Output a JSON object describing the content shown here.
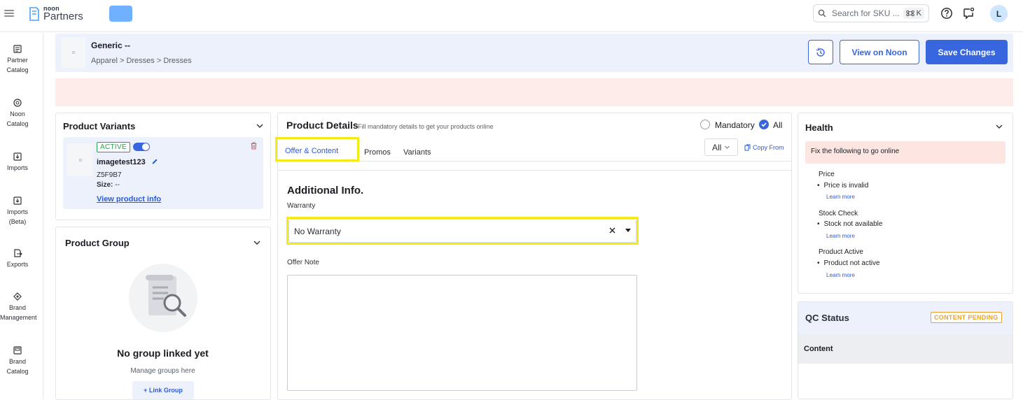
{
  "topbar": {
    "logo_noon": "noon",
    "logo_partners": "Partners",
    "search_placeholder": "Search for SKU ...",
    "search_shortcut_key": "K",
    "avatar_initial": "L"
  },
  "sidenav": {
    "items": [
      {
        "label": "Partner Catalog",
        "icon": "catalog-icon"
      },
      {
        "label": "Noon Catalog",
        "icon": "globe-catalog-icon"
      },
      {
        "label": "Imports",
        "icon": "import-icon"
      },
      {
        "label": "Imports (Beta)",
        "icon": "import-beta-icon"
      },
      {
        "label": "Exports",
        "icon": "export-icon"
      },
      {
        "label": "Brand Management",
        "icon": "brand-icon"
      },
      {
        "label": "Brand Catalog",
        "icon": "brand-catalog-icon"
      }
    ]
  },
  "header": {
    "product_title": "Generic --",
    "breadcrumb": "Apparel > Dresses > Dresses",
    "view_on_noon": "View on Noon",
    "save_changes": "Save Changes"
  },
  "variants": {
    "title": "Product Variants",
    "status_badge": "ACTIVE",
    "sku_name": "imagetest123",
    "sku_code": "Z5F9B7",
    "size_label": "Size:",
    "size_value": "--",
    "view_info": "View product info"
  },
  "group": {
    "title": "Product Group",
    "empty_title": "No group linked yet",
    "empty_sub": "Manage groups here",
    "link_button": "+ Link Group"
  },
  "details": {
    "title": "Product Details",
    "subtitle": "Fill mandatory details to get your products online",
    "filter_mandatory": "Mandatory",
    "filter_all": "All",
    "tabs": [
      "Offer & Content",
      "Promos",
      "Variants"
    ],
    "lang_select": "All",
    "copy_from": "Copy From",
    "section_title": "Additional Info.",
    "warranty_label": "Warranty",
    "warranty_value": "No Warranty",
    "offer_note_label": "Offer Note"
  },
  "health": {
    "title": "Health",
    "alert": "Fix the following to go online",
    "groups": [
      {
        "title": "Price",
        "item": "Price is invalid",
        "link": "Learn more"
      },
      {
        "title": "Stock Check",
        "item": "Stock not available",
        "link": "Learn more"
      },
      {
        "title": "Product Active",
        "item": "Product not active",
        "link": "Learn more"
      }
    ]
  },
  "qc": {
    "title": "QC Status",
    "badge": "CONTENT PENDING",
    "content_label": "Content"
  },
  "colors": {
    "primary": "#3866df",
    "highlight": "#f6ea16",
    "alert_bg": "#fdece9",
    "active_green": "#2ba14b",
    "pending_orange": "#e8a32a"
  }
}
